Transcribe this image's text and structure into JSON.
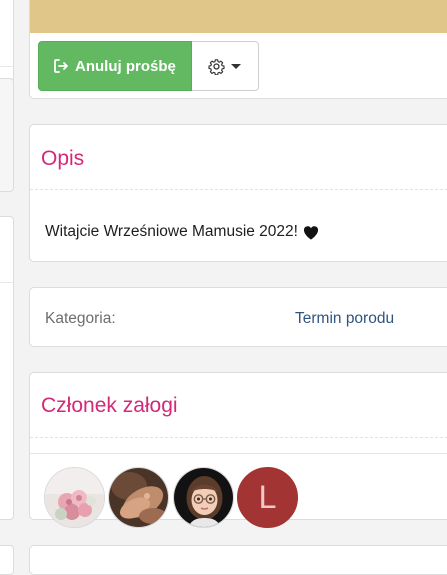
{
  "header": {
    "cancel_label": "Anuluj prośbę",
    "banner_color": "#e0c688",
    "primary_color": "#62b962"
  },
  "opis": {
    "title": "Opis",
    "text": "Witajcie Wrześniowe Mamusie 2022!",
    "accent_color": "#d42978"
  },
  "kategoria": {
    "label": "Kategoria:",
    "value": "Termin porodu"
  },
  "zaloga": {
    "title": "Członek załogi",
    "members": [
      {
        "type": "photo",
        "icon": "flowers-avatar"
      },
      {
        "type": "photo",
        "icon": "hands-avatar"
      },
      {
        "type": "photo",
        "icon": "woman-glasses-avatar"
      },
      {
        "type": "letter",
        "letter": "L",
        "color": "#a23433"
      }
    ]
  }
}
